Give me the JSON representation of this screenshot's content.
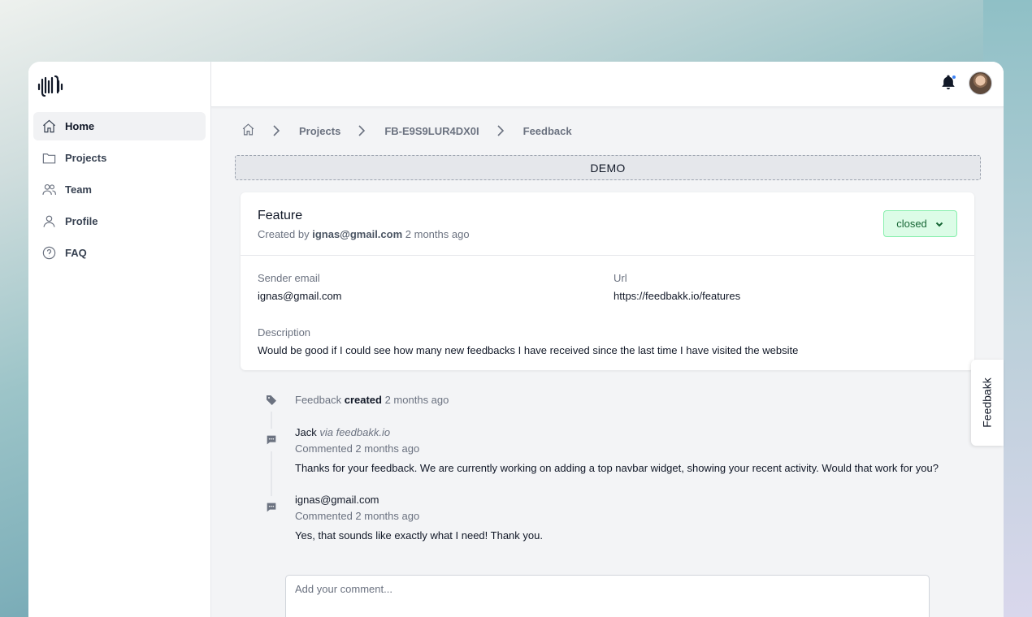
{
  "nav": {
    "items": [
      {
        "label": "Home",
        "icon": "home-icon",
        "active": true
      },
      {
        "label": "Projects",
        "icon": "folder-icon"
      },
      {
        "label": "Team",
        "icon": "users-icon"
      },
      {
        "label": "Profile",
        "icon": "user-icon"
      },
      {
        "label": "FAQ",
        "icon": "question-circle-icon"
      }
    ]
  },
  "topbar": {
    "notification_icon": "bell-icon",
    "notification_dot_color": "#3b82f6"
  },
  "breadcrumb": {
    "items": [
      "Projects",
      "FB-E9S9LUR4DX0I",
      "Feedback"
    ]
  },
  "banner": {
    "label": "DEMO"
  },
  "feedback": {
    "title": "Feature",
    "created_prefix": "Created by",
    "created_by": "ignas@gmail.com",
    "created_when": "2 months ago",
    "status": "closed",
    "status_color": "#dcfce7",
    "sender_email_label": "Sender email",
    "sender_email": "ignas@gmail.com",
    "url_label": "Url",
    "url": "https://feedbakk.io/features",
    "description_label": "Description",
    "description": "Would be good if I could see how many new feedbacks I have received since the last time I have visited the website"
  },
  "timeline": {
    "created": {
      "prefix": "Feedback",
      "action": "created",
      "when": "2 months ago"
    },
    "comments": [
      {
        "author": "Jack",
        "via": "via feedbakk.io",
        "meta": "Commented 2 months ago",
        "text": "Thanks for your feedback. We are currently working on adding a top navbar widget, showing your recent activity. Would that work for you?"
      },
      {
        "author": "ignas@gmail.com",
        "via": "",
        "meta": "Commented 2 months ago",
        "text": "Yes, that sounds like exactly what I need! Thank you."
      }
    ]
  },
  "comment_input": {
    "placeholder": "Add your comment..."
  },
  "feedback_widget": {
    "label": "Feedbakk"
  }
}
